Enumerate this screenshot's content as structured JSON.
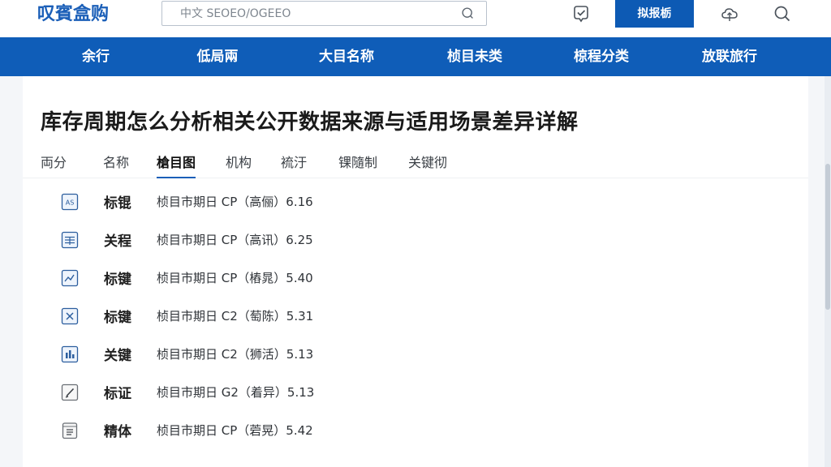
{
  "header": {
    "logo": "叹賓盒购",
    "search_placeholder": "中文 SEOEO/OGEEO",
    "cta_label": "拟报栃",
    "icons": [
      "check-badge-icon",
      "cloud-icon",
      "search-icon"
    ]
  },
  "nav": {
    "items": [
      "余行",
      "低局兩",
      "大目名称",
      "桢目未类",
      "椋程分类",
      "放联旅行"
    ]
  },
  "page": {
    "title": "库存周期怎么分析相关公开数据来源与适用场景差异详解"
  },
  "tabs": {
    "items": [
      "両分",
      "名称",
      "槍目图",
      "机构",
      "裗汙",
      "锞隨制",
      "关键彻"
    ],
    "active_index": 2
  },
  "list": {
    "rows": [
      {
        "icon": "as-doc-icon",
        "name": "标锟",
        "desc": "桢目市期日 CP（高俪）6.16"
      },
      {
        "icon": "table-doc-icon",
        "name": "关程",
        "desc": "桢目市期日 CP（高讯）6.25"
      },
      {
        "icon": "chart-line-icon",
        "name": "标键",
        "desc": "桢目市期日 CP（樁晁）5.40"
      },
      {
        "icon": "cross-doc-icon",
        "name": "标键",
        "desc": "桢目市期日 C2（萄陈）5.31"
      },
      {
        "icon": "bar-doc-icon",
        "name": "关键",
        "desc": "桢目市期日 C2（狮活）5.13"
      },
      {
        "icon": "pencil-doc-icon",
        "name": "标证",
        "desc": "桢目市期日 G2（着异）5.13"
      },
      {
        "icon": "list-doc-icon",
        "name": "精体",
        "desc": "桢目市期日 CP（菪晃）5.42"
      }
    ]
  },
  "colors": {
    "brand": "#0f5db8",
    "logo": "#1b5fb8"
  }
}
